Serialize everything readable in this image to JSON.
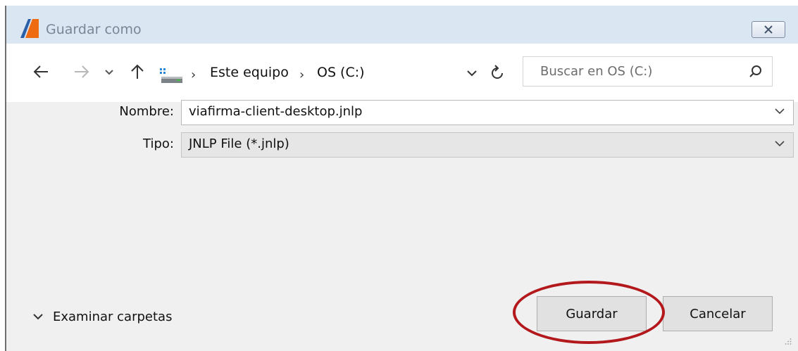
{
  "dialog": {
    "title": "Guardar como",
    "app_icon": "java-webstart-logo-icon"
  },
  "nav": {
    "address_icon": "computer-drive-icon",
    "breadcrumbs": [
      "Este equipo",
      "OS (C:)"
    ],
    "search_placeholder": "Buscar en OS (C:)"
  },
  "form": {
    "name_label": "Nombre:",
    "name_value": "viafirma-client-desktop.jnlp",
    "type_label": "Tipo:",
    "type_value": "JNLP File (*.jnlp)"
  },
  "footer": {
    "browse_folders_label": "Examinar carpetas",
    "save_label": "Guardar",
    "cancel_label": "Cancelar"
  },
  "colors": {
    "highlight_ring": "#b2181c",
    "titlebar": "#dbe6f3",
    "dialog_background": "#f0f0f0"
  }
}
